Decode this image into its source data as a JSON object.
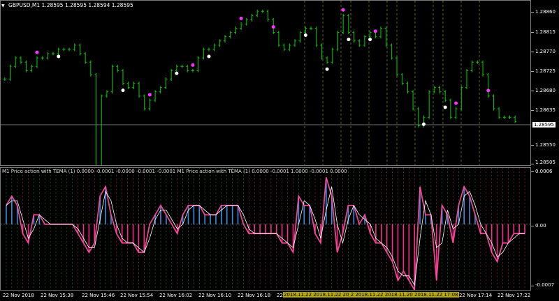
{
  "chart_title": {
    "symbol_timeframe": "GBPUSD,M1",
    "ohlc": "1.28595 1.28595 1.28594 1.28595",
    "menu_icon": "triangle-down-icon"
  },
  "indicator_title": "M1 Price action with TEMA (1) 0.0000 -0.0001 -0.0000 -0.0001 -0.0001  M1 Price action with TEMA (1) 0.0000 -0.0001 1.0000 -0.0001 0.0000",
  "price_axis": [
    "1.28860",
    "1.28815",
    "1.28770",
    "1.28725",
    "1.28680",
    "1.28635",
    "1.28550",
    "1.28505"
  ],
  "current_price": "1.28595",
  "indicator_axis": [
    "0.0006",
    "0.00",
    "-0.0007"
  ],
  "time_axis": [
    {
      "label": "22 Nov 2018",
      "highlight": false
    },
    {
      "label": "22 Nov 15:38",
      "highlight": false
    },
    {
      "label": "22 Nov 15:46",
      "highlight": false
    },
    {
      "label": "22 Nov 15:54",
      "highlight": false
    },
    {
      "label": "22 Nov 16:02",
      "highlight": false
    },
    {
      "label": "22 Nov 16:10",
      "highlight": false
    },
    {
      "label": "22 Nov 16:18",
      "highlight": false
    },
    {
      "label": "22 Nov 16:26",
      "highlight": false
    },
    {
      "label": "2018.11.22 2018.11.22 20  2 2018.11.22 2018.11.20  2018.11.22 17:08",
      "highlight": true
    },
    {
      "label": "22 Nov 17:14",
      "highlight": false
    },
    {
      "label": "22 Nov 17:22",
      "highlight": false
    }
  ],
  "colors": {
    "candle": "#00d000",
    "dot_up": "#ff33ff",
    "dot_down": "#ffffff",
    "hist_pos": "#3b8fe0",
    "hist_neg": "#ff2a8c",
    "vline_dash": "#8a8a20",
    "grid_green": "#2f7a2f",
    "grid_pink": "#a0305a"
  },
  "chart_data": {
    "type": "line",
    "price_series": [
      1.2869,
      1.2872,
      1.2874,
      1.2873,
      1.2871,
      1.2872,
      1.2874,
      1.2874,
      1.2875,
      1.2875,
      1.2876,
      1.2876,
      1.2876,
      1.2877,
      1.2875,
      1.2873,
      1.287,
      1.2667,
      1.2865,
      1.2866,
      1.2872,
      1.2871,
      1.2868,
      1.2867,
      1.2868,
      1.2865,
      1.2862,
      1.2864,
      1.2866,
      1.2867,
      1.2869,
      1.2871,
      1.2872,
      1.2872,
      1.2871,
      1.2871,
      1.2874,
      1.2876,
      1.2876,
      1.2877,
      1.2878,
      1.2879,
      1.288,
      1.2881,
      1.2882,
      1.2883,
      1.2884,
      1.2885,
      1.2885,
      1.2883,
      1.288,
      1.2877,
      1.2876,
      1.2877,
      1.2878,
      1.288,
      1.2881,
      1.2881,
      1.2877,
      1.2874,
      1.2873,
      1.2876,
      1.288,
      1.2884,
      1.288,
      1.2878,
      1.2877,
      1.2879,
      1.288,
      1.2879,
      1.2881,
      1.2877,
      1.2874,
      1.287,
      1.2868,
      1.2866,
      1.2862,
      1.2858,
      1.286,
      1.2866,
      1.2867,
      1.2866,
      1.2864,
      1.286,
      1.2862,
      1.2867,
      1.2871,
      1.2873,
      1.2873,
      1.287,
      1.2865,
      1.2862,
      1.286,
      1.286,
      1.286,
      1.2859
    ],
    "indicator_series": [
      0.0002,
      0.0003,
      0.0002,
      -0.0001,
      -0.0002,
      0.0001,
      0.0001,
      0.0,
      0.0,
      0.0,
      0.0,
      0.0,
      0.0,
      -0.0001,
      -0.0002,
      -0.0003,
      -0.0002,
      0.0003,
      0.0004,
      0.0001,
      -0.0001,
      -0.0002,
      -0.0002,
      -0.0002,
      -0.0003,
      -0.0003,
      0.0,
      0.0001,
      0.0002,
      0.0001,
      0.0,
      -0.0001,
      0.0001,
      0.0002,
      0.0002,
      0.0002,
      0.0001,
      0.0001,
      0.0001,
      0.0002,
      0.0002,
      0.0002,
      0.0002,
      0.0,
      -0.0001,
      -0.0001,
      -0.0001,
      -0.0001,
      -0.0001,
      -0.0001,
      -0.0002,
      -0.0002,
      -0.0003,
      0.0003,
      0.0002,
      0.0002,
      -0.0001,
      -0.0002,
      0.0005,
      0.0003,
      -0.0003,
      -0.0001,
      0.0002,
      0.0002,
      0.0,
      0.0001,
      -0.0001,
      -0.0002,
      -0.0002,
      -0.0003,
      -0.0004,
      -0.0006,
      -0.0005,
      -0.0006,
      -0.0007,
      0.0004,
      0.0001,
      0.0001,
      -0.0006,
      0.0002,
      0.0001,
      -0.0002,
      0.0002,
      0.0004,
      0.0003,
      0.0001,
      -0.0001,
      -0.0001,
      -0.0003,
      -0.0004,
      -0.0002,
      -0.0002,
      -0.0001,
      -0.0001,
      -0.0001
    ],
    "ylim_price": [
      1.28487,
      1.28875
    ],
    "ylim_indicator": [
      -0.0007,
      0.0006
    ]
  }
}
